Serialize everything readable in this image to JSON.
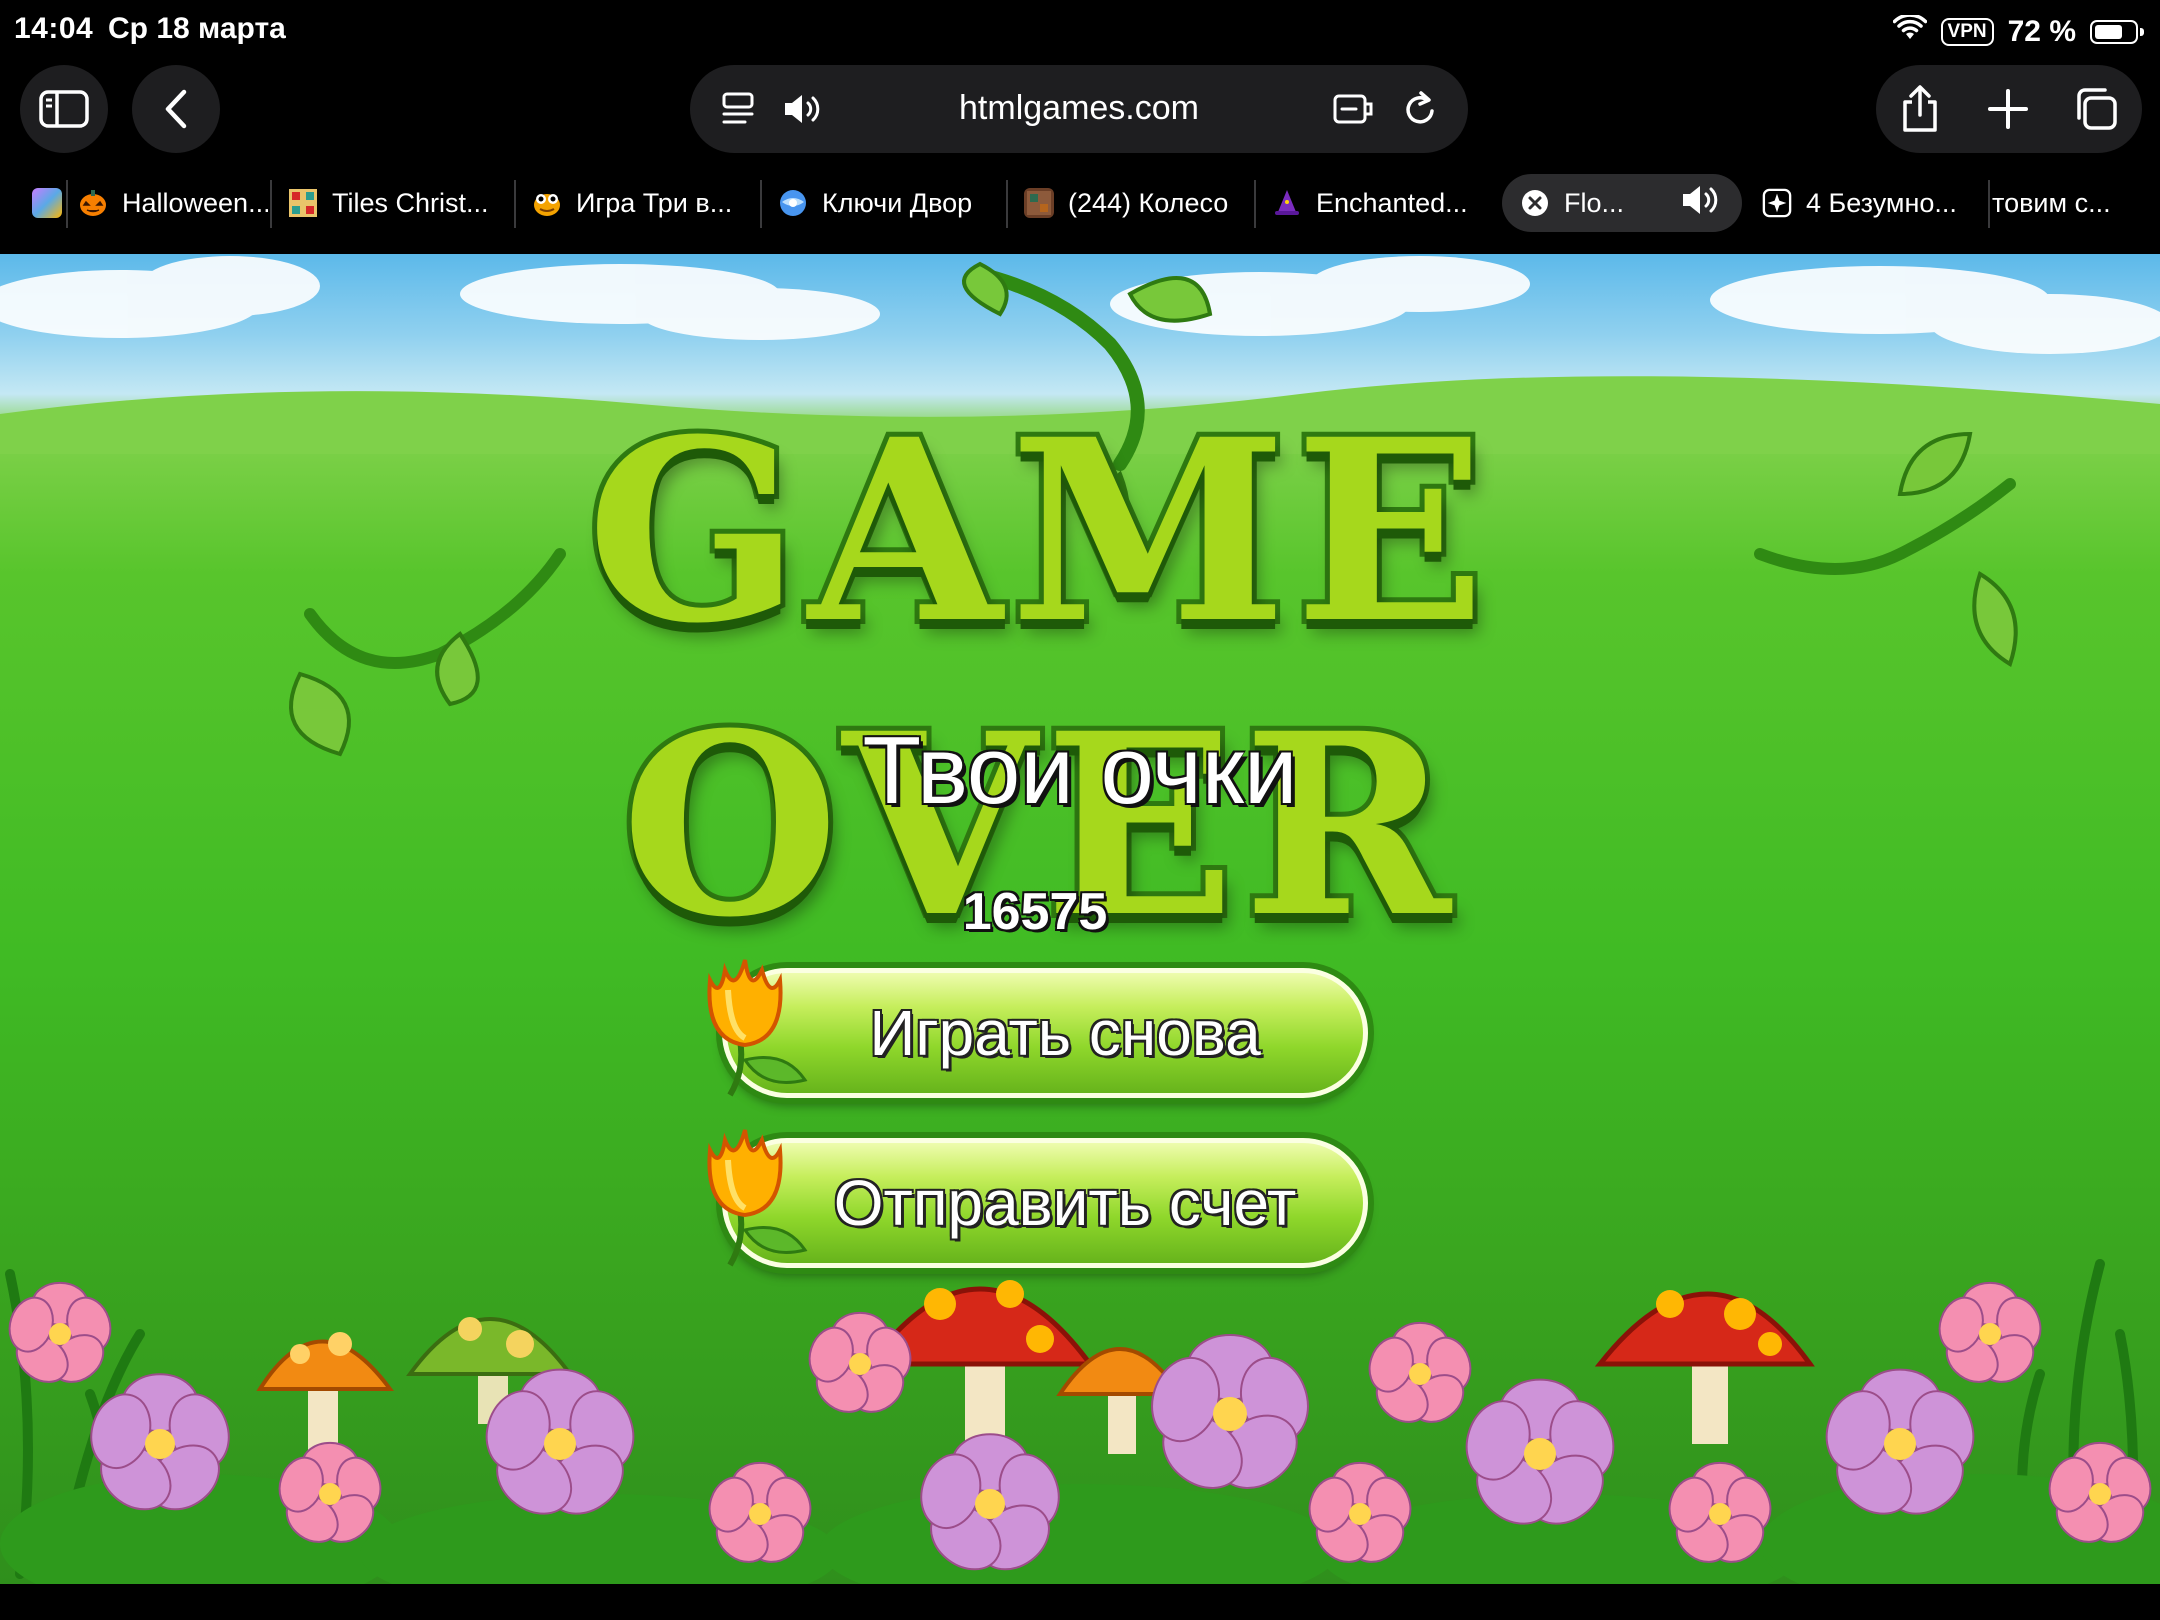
{
  "status": {
    "time": "14:04",
    "date": "Ср 18 марта",
    "vpn": "VPN",
    "battery": "72 %",
    "battery_level": 0.72
  },
  "toolbar": {
    "url": "htmlgames.com"
  },
  "tabs": [
    {
      "label": "",
      "favicon": "game-favicon"
    },
    {
      "label": "Halloween...",
      "favicon": "pumpkin-favicon"
    },
    {
      "label": "Tiles Christ...",
      "favicon": "tiles-favicon"
    },
    {
      "label": "Игра Три в...",
      "favicon": "frog-favicon"
    },
    {
      "label": "Ключи Двор",
      "favicon": "globe-favicon"
    },
    {
      "label": "(244) Колесо",
      "favicon": "wheel-favicon"
    },
    {
      "label": "Enchanted...",
      "favicon": "wizard-hat-favicon"
    },
    {
      "label": "Flo...",
      "favicon": "close-icon",
      "active": true
    },
    {
      "label": "4 Безумно...",
      "favicon": "sparkle-favicon"
    },
    {
      "label": "товим с...",
      "favicon": ""
    }
  ],
  "game": {
    "title": "GAME OVER",
    "score_label": "Твои очки",
    "score": "16575",
    "play_again": "Играть снова",
    "submit_score": "Отправить счет"
  },
  "colors": {
    "grass": "#40bb24",
    "button_green": "#8fd72b",
    "title_green": "#a6d81c",
    "title_outline": "#2f7a11"
  }
}
